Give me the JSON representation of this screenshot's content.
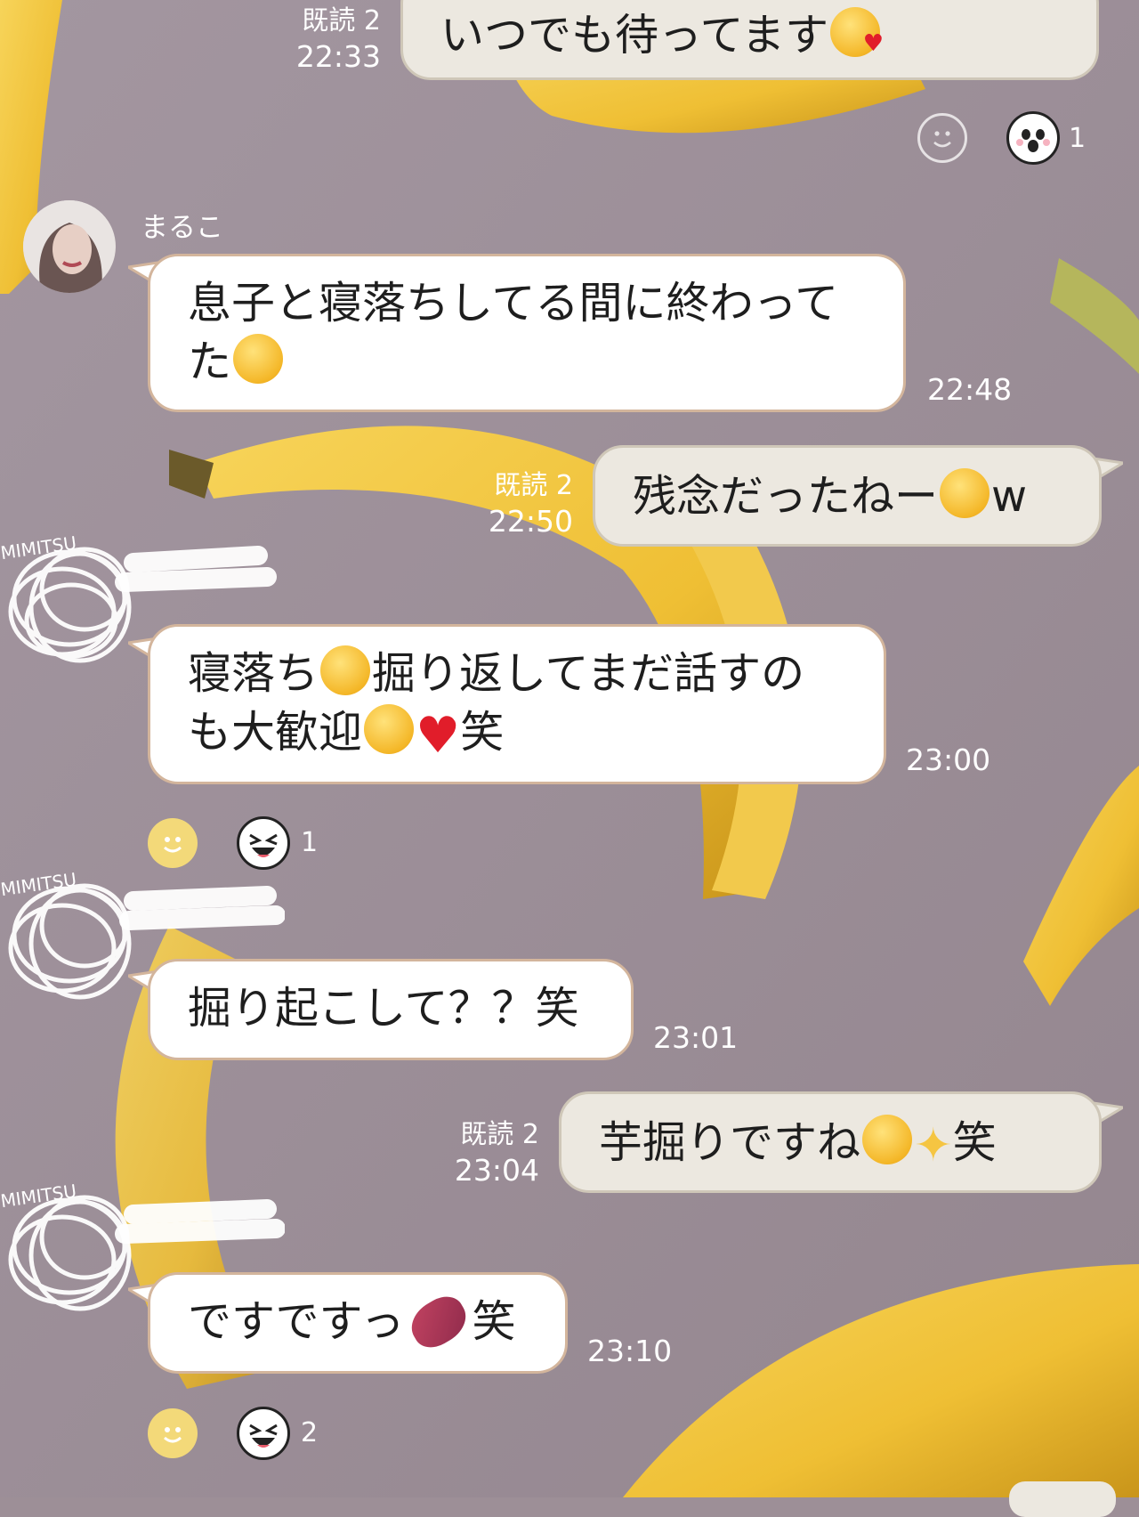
{
  "colors": {
    "background": "#9d8f97",
    "banana": "#f2c94c",
    "incoming_bubble": "#ffffff",
    "outgoing_bubble": "#ece8e0",
    "meta_text": "#ffffff"
  },
  "messages": [
    {
      "direction": "out",
      "text": "いつでも待ってます",
      "emoji": "kissing-face-with-heart",
      "read_label": "既読 2",
      "time": "22:33"
    },
    {
      "direction": "in",
      "sender": "まるこ",
      "text_line1": "息子と寝落ちしてる間に終わって",
      "text_line2": "た",
      "emoji": "rofl-face",
      "time": "22:48"
    },
    {
      "direction": "out",
      "text": "残念だったねー",
      "emoji": "smirking-face",
      "text_suffix": "w",
      "read_label": "既読 2",
      "time": "22:50"
    },
    {
      "direction": "in",
      "sender": "",
      "text_a": "寝落ち",
      "text_b": "掘り返してまだ話すの",
      "text_c": "も大歓迎",
      "text_d": "笑",
      "time": "23:00"
    },
    {
      "direction": "in",
      "sender": "",
      "text": "掘り起こして？？笑",
      "time": "23:01"
    },
    {
      "direction": "out",
      "text": "芋掘りですね",
      "text_suffix": "笑",
      "read_label": "既読 2",
      "time": "23:04"
    },
    {
      "direction": "in",
      "sender": "",
      "text": "ですですっ",
      "text_suffix": "笑",
      "time": "23:10"
    }
  ],
  "reactions": [
    {
      "after_message": 0,
      "icon": "smile-add-icon",
      "sticker": "sticker-face-icon",
      "count": "1"
    },
    {
      "after_message": 3,
      "icon": "smile-add-icon",
      "sticker": "laughing-face-icon",
      "count": "1"
    },
    {
      "after_message": 6,
      "icon": "smile-add-icon",
      "sticker": "laughing-face-icon",
      "count": "2"
    }
  ],
  "avatar_badge": "MIMITSU"
}
